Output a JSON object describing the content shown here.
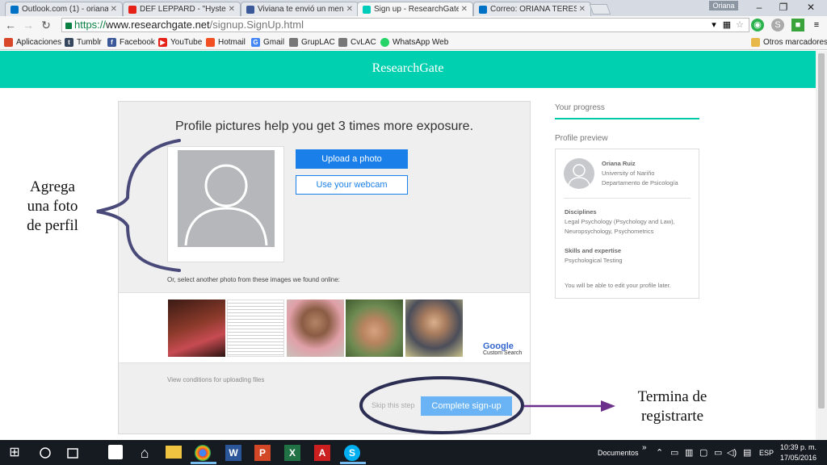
{
  "browser": {
    "tabs": [
      {
        "label": "Outlook.com (1) - oriana",
        "icon_color": "#0072c6"
      },
      {
        "label": "DEF LEPPARD - \"Hyste",
        "icon_color": "#e62117"
      },
      {
        "label": "Viviana te envió un mens",
        "icon_color": "#3b5998"
      },
      {
        "label": "Sign up - ResearchGate",
        "icon_color": "#00ccbb"
      },
      {
        "label": "Correo: ORIANA TERESA",
        "icon_color": "#0072c6"
      }
    ],
    "user_name": "Oriana",
    "url_scheme": "https://",
    "url_host": "www.researchgate.net",
    "url_path": "/signup.SignUp.html"
  },
  "bookmarks": [
    {
      "label": "Aplicaciones",
      "icon": "apps-grid-icon",
      "color": "#d9472b"
    },
    {
      "label": "Tumblr",
      "icon": "tumblr-icon",
      "color": "#36465d"
    },
    {
      "label": "Facebook",
      "icon": "facebook-icon",
      "color": "#3b5998"
    },
    {
      "label": "YouTube",
      "icon": "youtube-icon",
      "color": "#e62117"
    },
    {
      "label": "Hotmail",
      "icon": "hotmail-icon",
      "color": "#f25022"
    },
    {
      "label": "Gmail",
      "icon": "gmail-icon",
      "color": "#4285f4"
    },
    {
      "label": "GrupLAC",
      "icon": "gruplac-icon",
      "color": "#777777"
    },
    {
      "label": "CvLAC",
      "icon": "cvlac-icon",
      "color": "#777777"
    },
    {
      "label": "WhatsApp Web",
      "icon": "whatsapp-icon",
      "color": "#25d366"
    },
    {
      "label": "Otros marcadores",
      "icon": "folder-icon",
      "color": "#e8b84a"
    }
  ],
  "page": {
    "brand": "ResearchGate",
    "headline": "Profile pictures help you get 3 times more exposure.",
    "upload_label": "Upload a photo",
    "webcam_label": "Use your webcam",
    "or_select_text": "Or, select another photo from these images we found online:",
    "google_label": "Google",
    "custom_search_label": "Custom Search",
    "conditions_text": "View conditions for uploading files",
    "skip_label": "Skip this step",
    "complete_label": "Complete sign-up"
  },
  "sidebar": {
    "progress_label": "Your progress",
    "preview_label": "Profile preview",
    "name": "Oriana Ruiz",
    "university": "University of Nariño",
    "department": "Departamento de Psicología",
    "disciplines_label": "Disciplines",
    "disciplines_line1": "Legal Psychology (Psychology and Law),",
    "disciplines_line2": "Neuropsychology, Psychometrics",
    "skills_label": "Skills and expertise",
    "skills_value": "Psychological Testing",
    "edit_note": "You will be able to edit your profile later."
  },
  "annotations": {
    "left_line1": "Agrega",
    "left_line2": "una foto",
    "left_line3": "de perfil",
    "right_line1": "Termina de",
    "right_line2": "registrarte"
  },
  "taskbar": {
    "documents_label": "Documentos",
    "lang": "ESP",
    "time": "10:39 p. m.",
    "date": "17/05/2016"
  }
}
